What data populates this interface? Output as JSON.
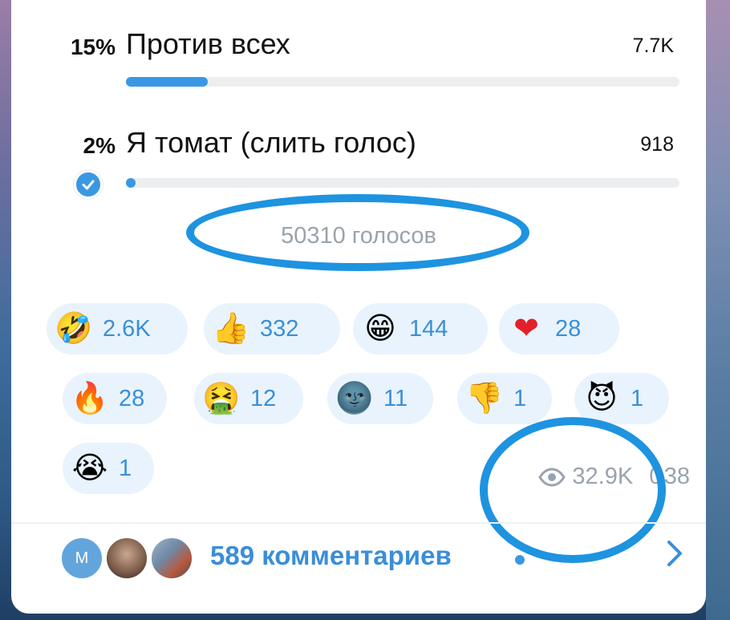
{
  "poll": {
    "options": [
      {
        "percent": "15%",
        "text": "Против всех",
        "count": "7.7K",
        "fill": 0.15,
        "checked": false
      },
      {
        "percent": "2%",
        "text": "Я томат (слить голос)",
        "count": "918",
        "fill": 0.02,
        "checked": true
      }
    ],
    "total_votes": "50310 голосов"
  },
  "reactions": [
    {
      "icon": "rofl-emoji",
      "glyph": "🤣",
      "count": "2.6K"
    },
    {
      "icon": "thumbs-up-emoji",
      "glyph": "👍",
      "count": "332"
    },
    {
      "icon": "grin-emoji",
      "glyph": "😁",
      "count": "144"
    },
    {
      "icon": "heart-emoji",
      "glyph": "❤",
      "count": "28"
    },
    {
      "icon": "fire-emoji",
      "glyph": "🔥",
      "count": "28"
    },
    {
      "icon": "vomit-emoji",
      "glyph": "🤮",
      "count": "12"
    },
    {
      "icon": "new-moon-face-emoji",
      "glyph": "🌚",
      "count": "11"
    },
    {
      "icon": "thumbs-down-emoji",
      "glyph": "👎",
      "count": "1"
    },
    {
      "icon": "smiling-imp-emoji",
      "glyph": "😈",
      "count": "1"
    },
    {
      "icon": "crying-emoji",
      "glyph": "😭",
      "count": "1"
    }
  ],
  "meta": {
    "views": "32.9K",
    "time": "0 38"
  },
  "comments": {
    "avatar_letter": "M",
    "label": "589 комментариев"
  },
  "colors": {
    "accent": "#3a98e3",
    "annotation_circle": "#1e93e0",
    "chip_bg": "#e8f3fd"
  }
}
